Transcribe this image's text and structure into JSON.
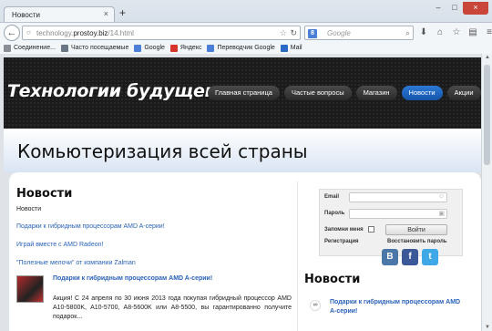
{
  "browser": {
    "tab_title": "Новости",
    "tab_close": "×",
    "new_tab": "+",
    "url_host": "technology.",
    "url_domain": "prostoy.biz",
    "url_path": "/14.html",
    "search_placeholder": "Google",
    "window_buttons": [
      "–",
      "□",
      "×"
    ],
    "bookmarks": [
      {
        "label": "Соединение...",
        "icon": "connection-icon",
        "color": "#8a8f96"
      },
      {
        "label": "Часто посещаемые",
        "icon": "clock-icon",
        "color": "#6a7685"
      },
      {
        "label": "Google",
        "icon": "google-icon",
        "color": "#4a7fd8"
      },
      {
        "label": "Яндекс",
        "icon": "yandex-icon",
        "color": "#d6332b"
      },
      {
        "label": "Переводчик Google",
        "icon": "translate-icon",
        "color": "#4a7fd8"
      },
      {
        "label": "Mail",
        "icon": "mail-icon",
        "color": "#2a69c5"
      }
    ]
  },
  "site": {
    "title": "Технологии будущего",
    "nav": [
      {
        "label": "Главная страница",
        "active": false
      },
      {
        "label": "Частые вопросы",
        "active": false
      },
      {
        "label": "Магазин",
        "active": false
      },
      {
        "label": "Новости",
        "active": true
      },
      {
        "label": "Акции",
        "active": false
      }
    ],
    "hero_title": "Комьютеризация всей страны"
  },
  "main": {
    "heading": "Новости",
    "subheading": "Новости",
    "links": [
      "Подарки к гибридным процессорам AMD A-серии!",
      "Играй вместе с AMD Radeon!",
      "\"Полезные мелочи\" от компании Zalman"
    ],
    "featured": {
      "title": "Подарки к гибридным процессорам AMD A-серии!",
      "text": "Акция! С 24 апреля по 30 июня 2013 года покупая гибридный процессор AMD A10-5800K, A10-5700, A8-5600K или A8-5500, вы гарантированно получите подарок..."
    }
  },
  "login": {
    "email_label": "Email",
    "password_label": "Пароль",
    "remember_label": "Запомни меня",
    "submit_label": "Войти",
    "register_label": "Регистрация",
    "restore_label": "Восстановить пароль"
  },
  "socials": [
    {
      "name": "vk",
      "glyph": "B",
      "color": "#4a76a8"
    },
    {
      "name": "facebook",
      "glyph": "f",
      "color": "#3b5998"
    },
    {
      "name": "twitter",
      "glyph": "t",
      "color": "#3fa9e8"
    }
  ],
  "side_news": {
    "heading": "Новости",
    "item": "Подарки к гибридным процессорам AMD A-серии!"
  }
}
